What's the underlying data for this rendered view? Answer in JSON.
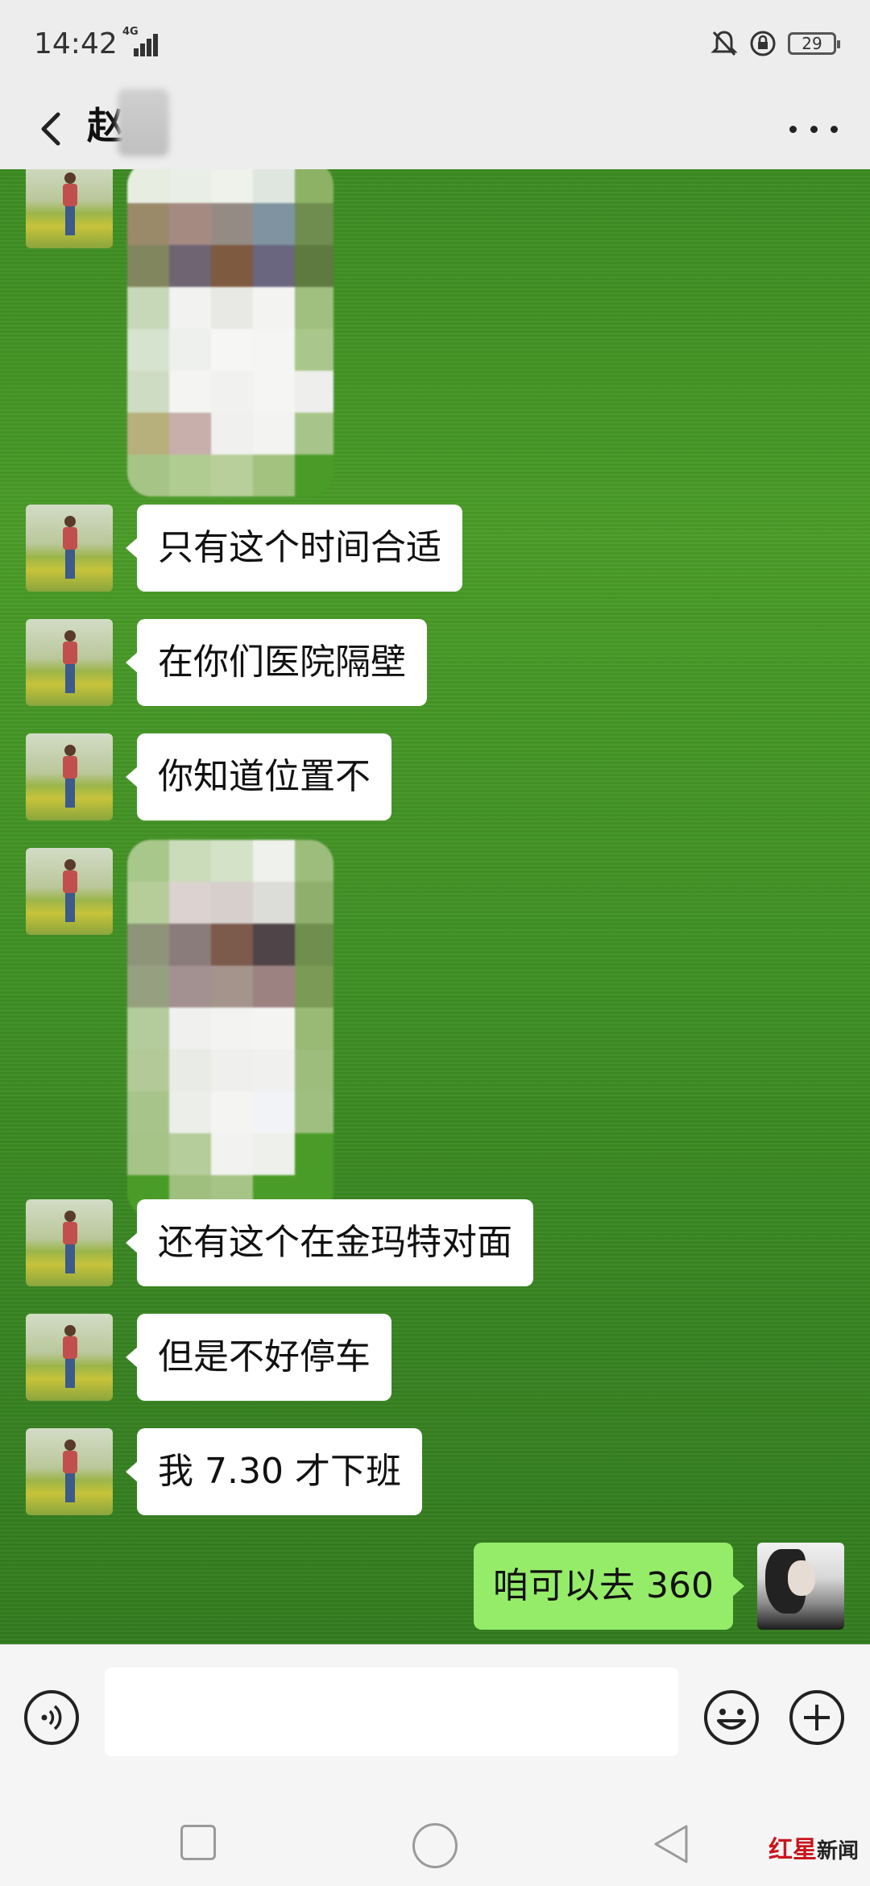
{
  "status_bar": {
    "time": "14:42",
    "network": "4G",
    "battery": "29"
  },
  "header": {
    "contact_name": "赵"
  },
  "messages": [
    {
      "text": "只有这个时间合适"
    },
    {
      "text": "在你们医院隔壁"
    },
    {
      "text": "你知道位置不"
    },
    {
      "text": "还有这个在金玛特对面"
    },
    {
      "text": "但是不好停车"
    },
    {
      "text": "我 7.30 才下班"
    }
  ],
  "sent_message": {
    "text": "咱可以去 360"
  },
  "input_bar": {
    "placeholder": ""
  },
  "watermark": {
    "red": "红星",
    "black": "新闻"
  },
  "colors": {
    "sent_bubble": "#95ec69",
    "received_bubble": "#ffffff",
    "chat_background": "#3f8f24"
  },
  "icons": [
    "back-icon",
    "more-icon",
    "voice-icon",
    "emoji-icon",
    "plus-icon",
    "nav-recent-icon",
    "nav-home-icon",
    "nav-back-icon"
  ]
}
